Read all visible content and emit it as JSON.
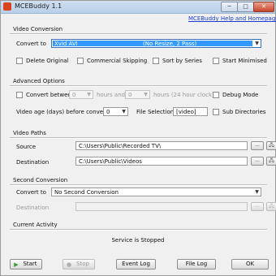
{
  "window": {
    "title": "MCEBuddy 1.1",
    "minimize": "─",
    "maximize": "□",
    "close": "✕"
  },
  "help_link": "MCEBuddy Help and Homepage",
  "video_conversion": {
    "section": "Video Conversion",
    "convert_to_label": "Convert to",
    "profile_name": "Xvid AVI",
    "profile_detail": "(No Resize, 2 Pass)",
    "delete_original": "Delete Original",
    "commercial_skipping": "Commercial Skipping",
    "sort_by_series": "Sort by Series",
    "start_minimised": "Start Minimised"
  },
  "advanced": {
    "section": "Advanced Options",
    "convert_between": "Convert between",
    "hour_start": "0",
    "hours_and": "hours and",
    "hour_end": "0",
    "hours_24": "hours (24 hour clock)",
    "debug_mode": "Debug Mode",
    "video_age_label": "Video age (days) before conversion",
    "video_age_value": "0",
    "file_selection_label": "File Selection",
    "file_selection_value": "[video]",
    "sub_directories": "Sub Directories"
  },
  "paths": {
    "section": "Video Paths",
    "source_label": "Source",
    "source_value": "C:\\Users\\Public\\Recorded TV\\",
    "destination_label": "Destination",
    "destination_value": "C:\\Users\\Public\\Videos",
    "browse": "..."
  },
  "second": {
    "section": "Second Conversion",
    "convert_to_label": "Convert to",
    "value": "No Second Conversion",
    "destination_label": "Destination"
  },
  "activity": {
    "section": "Current Activity",
    "status": "Service is Stopped"
  },
  "buttons": {
    "start": "Start",
    "stop": "Stop",
    "event_log": "Event Log",
    "file_log": "File Log",
    "ok": "OK"
  },
  "colors": {
    "selection": "#3399ff",
    "link": "#1a3ccf",
    "start_icon": "#2e9e2e"
  }
}
